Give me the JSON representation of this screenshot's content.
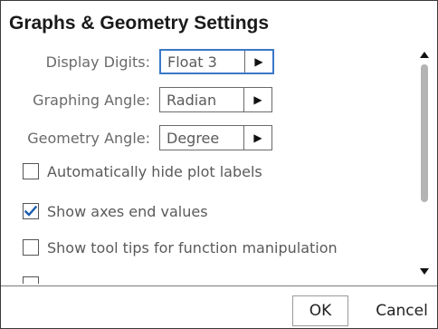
{
  "dialog": {
    "title": "Graphs & Geometry Settings"
  },
  "settings": [
    {
      "label": "Display Digits:",
      "value": "Float 3",
      "focused": true
    },
    {
      "label": "Graphing Angle:",
      "value": "Radian",
      "focused": false
    },
    {
      "label": "Geometry Angle:",
      "value": "Degree",
      "focused": false
    }
  ],
  "checkboxes": [
    {
      "label": "Automatically hide plot labels",
      "checked": false
    },
    {
      "label": "Show axes end values",
      "checked": true
    },
    {
      "label": "Show tool tips for function manipulation",
      "checked": false
    }
  ],
  "buttons": {
    "ok": "OK",
    "cancel": "Cancel"
  },
  "colors": {
    "focus_border": "#3a78c8",
    "check_mark": "#1f5fb0",
    "scroll_thumb": "#b4b4b4"
  },
  "icons": {
    "dropdown": "triangle-right-icon",
    "check": "checkmark-icon",
    "scroll_up": "arrow-up-icon",
    "scroll_down": "arrow-down-icon"
  }
}
